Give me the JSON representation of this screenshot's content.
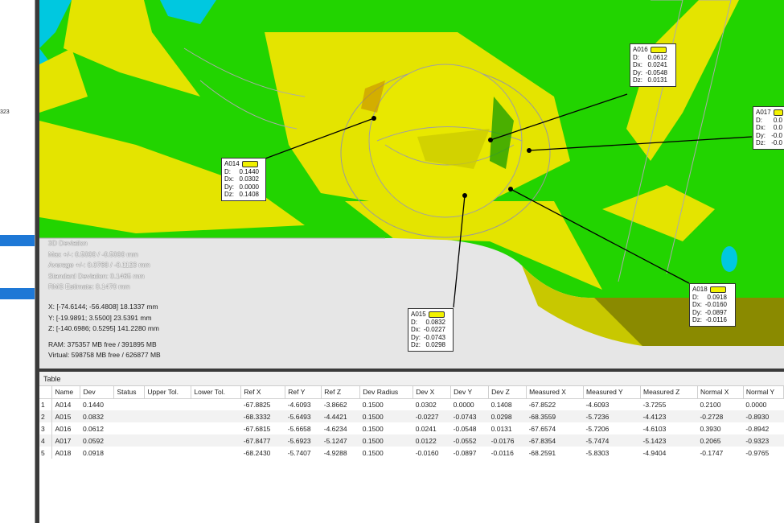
{
  "left_panel": {
    "fragments": [
      "323"
    ]
  },
  "info": {
    "title": "3D Deviation",
    "max": "Max +/-: 0.5000 / -0.5000 mm",
    "average": "Average +/-: 0.0768 / -0.1123 mm",
    "std": "Standard Deviation: 0.1465 mm",
    "rms": "RMS Estimate: 0.1470 mm",
    "x": "X: [-74.6144; -56.4808] 18.1337 mm",
    "y": "Y: [-19.9891; 3.5500] 23.5391 mm",
    "z": "Z: [-140.6986; 0.5295] 141.2280 mm",
    "ram": "RAM: 375357 MB free / 391895 MB",
    "virtual": "Virtual: 598758 MB free / 626877 MB"
  },
  "callouts": [
    {
      "name": "A014",
      "D": "0.1440",
      "Dx": "0.0302",
      "Dy": "0.0000",
      "Dz": "0.1408"
    },
    {
      "name": "A015",
      "D": "0.0832",
      "Dx": "-0.0227",
      "Dy": "-0.0743",
      "Dz": "0.0298"
    },
    {
      "name": "A016",
      "D": "0.0612",
      "Dx": "0.0241",
      "Dy": "-0.0548",
      "Dz": "0.0131"
    },
    {
      "name": "A017",
      "D": "0.0",
      "Dx": "0.0",
      "Dy": "-0.0",
      "Dz": "-0.0"
    },
    {
      "name": "A018",
      "D": "0.0918",
      "Dx": "-0.0160",
      "Dy": "-0.0897",
      "Dz": "-0.0116"
    }
  ],
  "callout_labels": {
    "D": "D:",
    "Dx": "Dx:",
    "Dy": "Dy:",
    "Dz": "Dz:"
  },
  "table": {
    "title": "Table",
    "columns": [
      "Name",
      "Dev",
      "Status",
      "Upper Tol.",
      "Lower Tol.",
      "Ref X",
      "Ref Y",
      "Ref Z",
      "Dev Radius",
      "Dev X",
      "Dev Y",
      "Dev Z",
      "Measured X",
      "Measured Y",
      "Measured Z",
      "Normal X",
      "Normal Y"
    ],
    "rows": [
      [
        "1",
        "A014",
        "0.1440",
        "",
        "",
        "",
        "-67.8825",
        "-4.6093",
        "-3.8662",
        "0.1500",
        "0.0302",
        "0.0000",
        "0.1408",
        "-67.8522",
        "-4.6093",
        "-3.7255",
        "0.2100",
        "0.0000"
      ],
      [
        "2",
        "A015",
        "0.0832",
        "",
        "",
        "",
        "-68.3332",
        "-5.6493",
        "-4.4421",
        "0.1500",
        "-0.0227",
        "-0.0743",
        "0.0298",
        "-68.3559",
        "-5.7236",
        "-4.4123",
        "-0.2728",
        "-0.8930"
      ],
      [
        "3",
        "A016",
        "0.0612",
        "",
        "",
        "",
        "-67.6815",
        "-5.6658",
        "-4.6234",
        "0.1500",
        "0.0241",
        "-0.0548",
        "0.0131",
        "-67.6574",
        "-5.7206",
        "-4.6103",
        "0.3930",
        "-0.8942"
      ],
      [
        "4",
        "A017",
        "0.0592",
        "",
        "",
        "",
        "-67.8477",
        "-5.6923",
        "-5.1247",
        "0.1500",
        "0.0122",
        "-0.0552",
        "-0.0176",
        "-67.8354",
        "-5.7474",
        "-5.1423",
        "0.2065",
        "-0.9323"
      ],
      [
        "5",
        "A018",
        "0.0918",
        "",
        "",
        "",
        "-68.2430",
        "-5.7407",
        "-4.9288",
        "0.1500",
        "-0.0160",
        "-0.0897",
        "-0.0116",
        "-68.2591",
        "-5.8303",
        "-4.9404",
        "-0.1747",
        "-0.9765"
      ]
    ]
  },
  "colors": {
    "green": "#22d400",
    "yellow": "#e4e400",
    "cyan": "#00c8e0",
    "olive": "#8a8a00"
  }
}
